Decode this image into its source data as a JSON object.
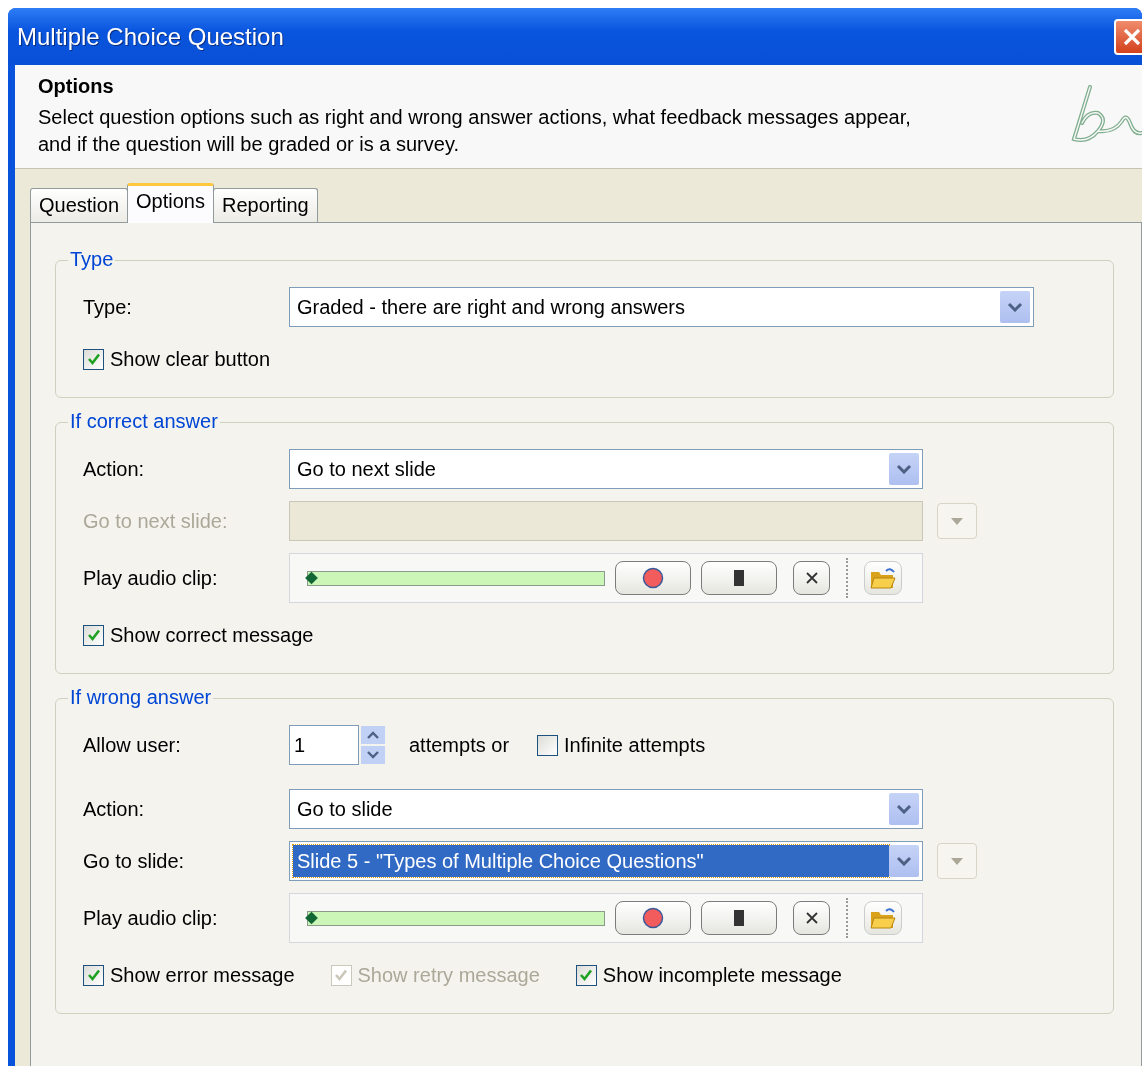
{
  "window": {
    "title": "Multiple Choice Question"
  },
  "header": {
    "title": "Options",
    "description": "Select question options such as right and wrong answer actions, what feedback messages appear, and if the question will be graded or is a survey."
  },
  "tabs": [
    {
      "label": "Question",
      "selected": false
    },
    {
      "label": "Options",
      "selected": true
    },
    {
      "label": "Reporting",
      "selected": false
    }
  ],
  "sections": [
    {
      "title": "Type",
      "rows": [
        {
          "kind": "wide-combo",
          "label": "Type:",
          "value": "Graded - there are right and wrong answers"
        },
        {
          "kind": "checks",
          "items": [
            {
              "label": "Show clear button",
              "checked": true,
              "disabled": false
            }
          ]
        }
      ]
    },
    {
      "title": "If correct answer",
      "rows": [
        {
          "kind": "combo",
          "label": "Action:",
          "value": "Go to next slide"
        },
        {
          "kind": "combo",
          "label": "Go to next slide:",
          "disabled": true,
          "side_button": true
        },
        {
          "kind": "audio",
          "label": "Play audio clip:",
          "level": 0
        },
        {
          "kind": "checks",
          "items": [
            {
              "label": "Show correct message",
              "checked": true,
              "disabled": false
            }
          ]
        }
      ]
    },
    {
      "title": "If wrong answer",
      "rows": [
        {
          "kind": "spinner",
          "label": "Allow user:",
          "value": "1",
          "suffix": "attempts or",
          "check": {
            "label": "Infinite attempts",
            "checked": false,
            "disabled": false
          }
        },
        {
          "kind": "combo",
          "label": "Action:",
          "value": "Go to slide"
        },
        {
          "kind": "combo",
          "label": "Go to slide:",
          "value": "Slide 5 - \"Types of Multiple Choice Questions\"",
          "highlighted": true,
          "side_button": true
        },
        {
          "kind": "audio",
          "label": "Play audio clip:",
          "level": 0
        },
        {
          "kind": "checks",
          "items": [
            {
              "label": "Show error message",
              "checked": true,
              "disabled": false
            },
            {
              "label": "Show retry message",
              "checked": true,
              "disabled": true
            },
            {
              "label": "Show incomplete message",
              "checked": true,
              "disabled": false
            }
          ]
        }
      ]
    }
  ]
}
